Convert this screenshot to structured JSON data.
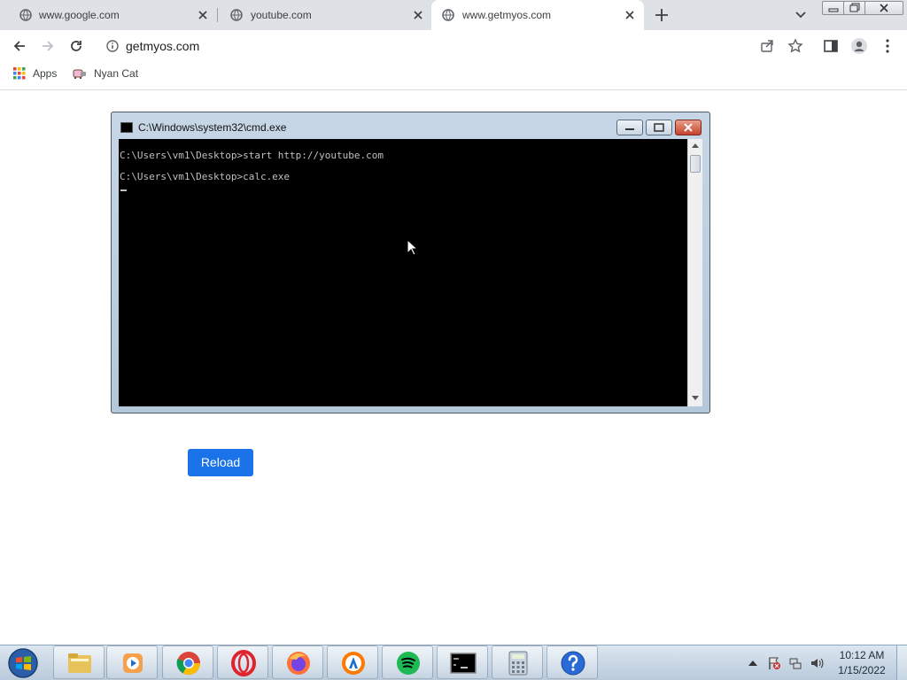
{
  "browser": {
    "tabs": [
      {
        "title": "www.google.com",
        "active": false
      },
      {
        "title": "youtube.com",
        "active": false
      },
      {
        "title": "www.getmyos.com",
        "active": true
      }
    ],
    "address": "getmyos.com",
    "bookmarks": [
      {
        "label": "Apps",
        "icon": "apps-grid-icon"
      },
      {
        "label": "Nyan Cat",
        "icon": "nyan-cat-icon"
      }
    ]
  },
  "cmd_window": {
    "title": "C:\\Windows\\system32\\cmd.exe",
    "lines": [
      "C:\\Users\\vm1\\Desktop>start http://youtube.com",
      "C:\\Users\\vm1\\Desktop>calc.exe"
    ]
  },
  "page": {
    "reload_label": "Reload"
  },
  "taskbar": {
    "apps": [
      "start-orb",
      "file-explorer",
      "media-player",
      "chrome",
      "opera",
      "firefox",
      "avast",
      "spotify",
      "cmd",
      "calculator",
      "help"
    ],
    "clock_time": "10:12 AM",
    "clock_date": "1/15/2022"
  },
  "colors": {
    "accent": "#1a73e8",
    "tabstrip": "#dee1e6",
    "console_bg": "#000000",
    "console_text": "#c0c0c0"
  }
}
